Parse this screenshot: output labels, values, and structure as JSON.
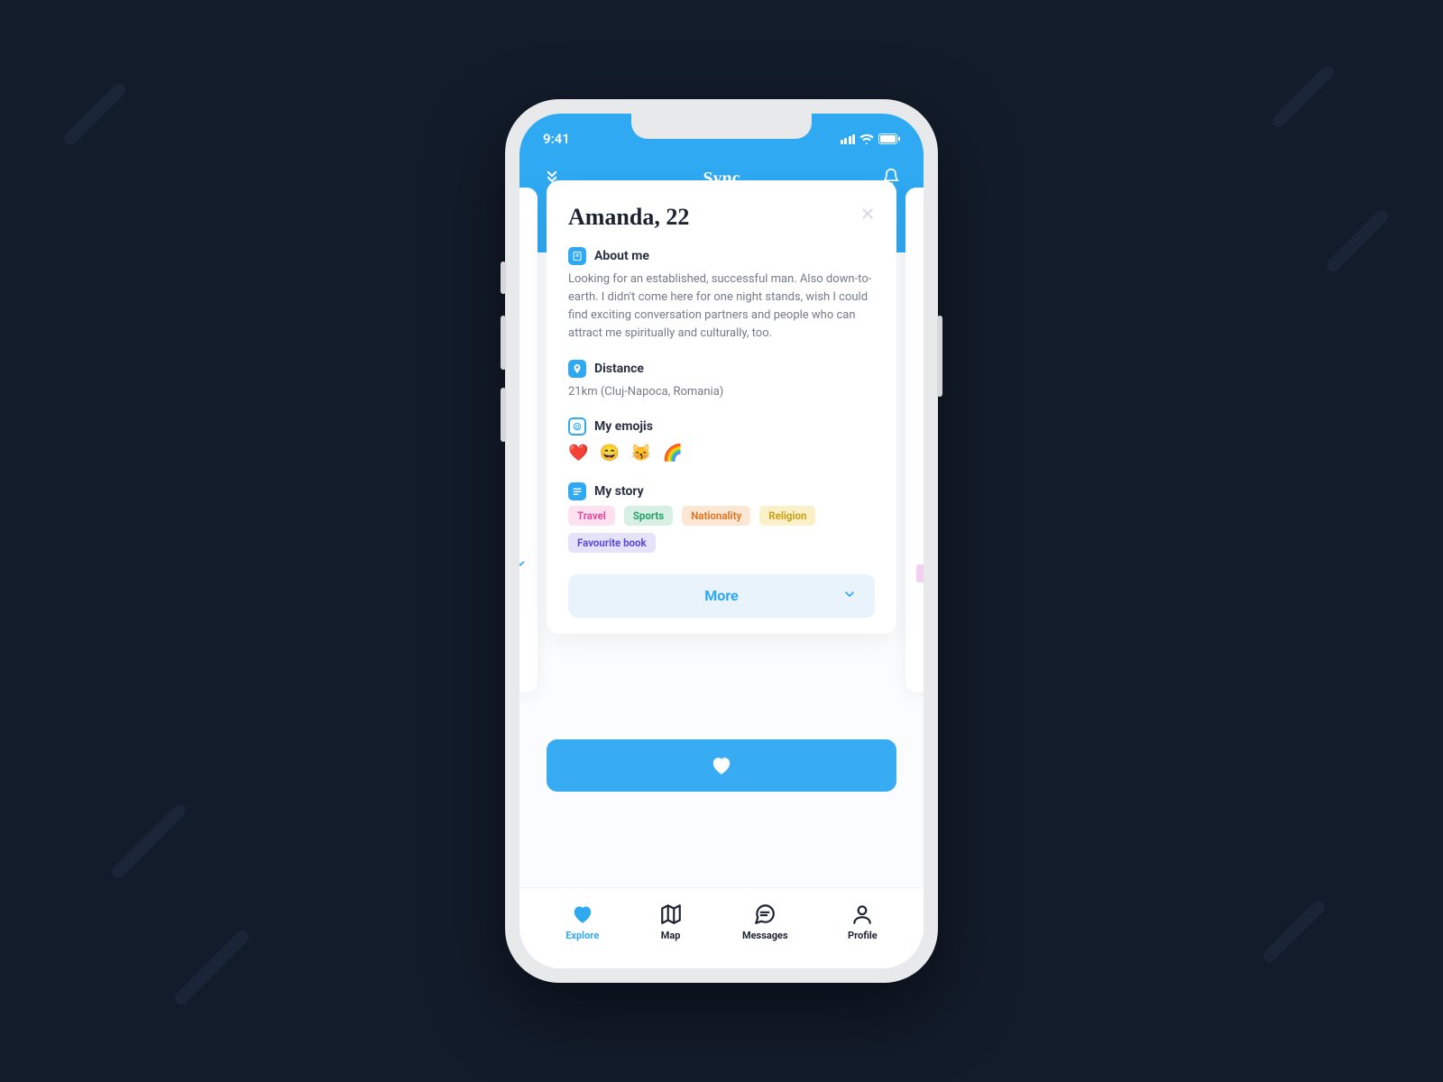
{
  "status": {
    "time": "9:41"
  },
  "header": {
    "title": "Sync"
  },
  "profile": {
    "name": "Amanda",
    "age": "22",
    "title": "Amanda, 22",
    "about_label": "About me",
    "about_text": "Looking for an established, successful man. Also down-to-earth. I didn't come here for one night stands, wish I could find exciting conversation partners and people who can attract me spiritually and culturally, too.",
    "distance_label": "Distance",
    "distance_text": "21km (Cluj-Napoca, Romania)",
    "emojis_label": "My emojis",
    "emojis_text": "❤️ 😄 😽 🌈",
    "story_label": "My story",
    "tags": [
      {
        "label": "Travel",
        "fg": "#e04da0",
        "bg": "#fde1ef"
      },
      {
        "label": "Sports",
        "fg": "#2aa06a",
        "bg": "#d7f0e3"
      },
      {
        "label": "Nationality",
        "fg": "#e07a2a",
        "bg": "#fce7d4"
      },
      {
        "label": "Religion",
        "fg": "#c9a21a",
        "bg": "#fbf1c8"
      },
      {
        "label": "Favourite book",
        "fg": "#5a4dd6",
        "bg": "#e5e2fa"
      }
    ],
    "more_label": "More"
  },
  "tabs": [
    {
      "label": "Explore",
      "active": true
    },
    {
      "label": "Map",
      "active": false
    },
    {
      "label": "Messages",
      "active": false
    },
    {
      "label": "Profile",
      "active": false
    }
  ]
}
